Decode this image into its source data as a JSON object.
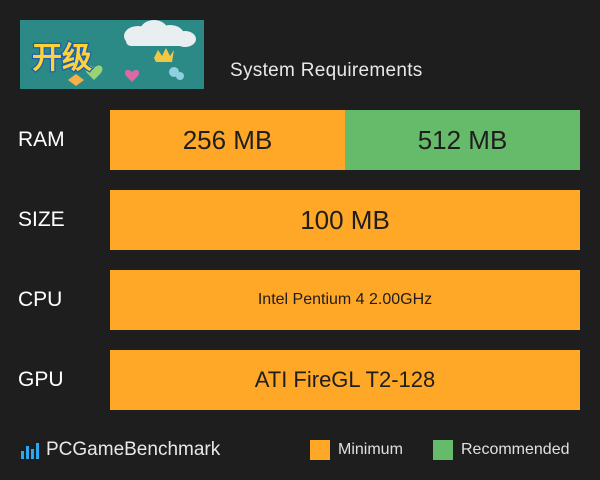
{
  "header": {
    "banner_text": "开级",
    "title": "System Requirements"
  },
  "rows": [
    {
      "label": "RAM",
      "minimum": "256 MB",
      "recommended": "512 MB"
    },
    {
      "label": "SIZE",
      "minimum": "100 MB"
    },
    {
      "label": "CPU",
      "minimum": "Intel Pentium 4 2.00GHz"
    },
    {
      "label": "GPU",
      "minimum": "ATI FireGL T2-128"
    }
  ],
  "footer": {
    "brand": "PCGameBenchmark",
    "brand_icon": "bar-chart-icon",
    "legend": {
      "minimum": "Minimum",
      "recommended": "Recommended"
    }
  },
  "colors": {
    "background": "#1e1e1e",
    "minimum": "#ffa726",
    "recommended": "#66bb6a"
  }
}
